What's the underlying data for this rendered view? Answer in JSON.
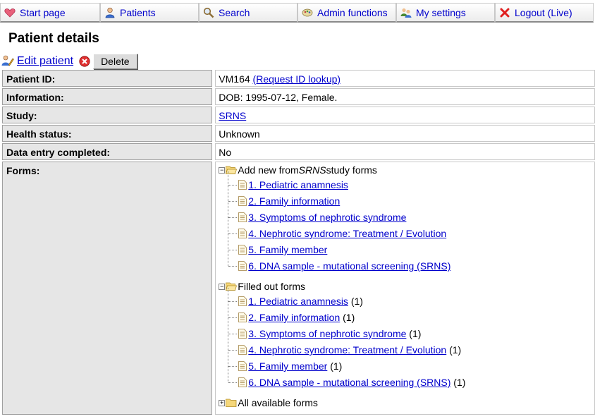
{
  "nav": {
    "items": [
      {
        "label": "Start page",
        "icon": "heart-icon"
      },
      {
        "label": "Patients",
        "icon": "person-icon"
      },
      {
        "label": "Search",
        "icon": "magnifier-icon"
      },
      {
        "label": "Admin functions",
        "icon": "admin-icon"
      },
      {
        "label": "My settings",
        "icon": "users-settings-icon"
      },
      {
        "label": "Logout (Live)",
        "icon": "red-x-icon"
      }
    ]
  },
  "page": {
    "title": "Patient details",
    "edit_label": "Edit patient",
    "delete_label": "Delete"
  },
  "details": {
    "patient_id_label": "Patient ID:",
    "patient_id_value": "VM164",
    "id_lookup_link": "(Request ID lookup)",
    "information_label": "Information:",
    "information_value": "DOB: 1995-07-12, Female.",
    "study_label": "Study:",
    "study_value": "SRNS",
    "health_label": "Health status:",
    "health_value": "Unknown",
    "completed_label": "Data entry completed:",
    "completed_value": "No",
    "forms_label": "Forms:"
  },
  "forms": {
    "add_new": {
      "prefix": "Add new from ",
      "study": "SRNS",
      "suffix": " study forms",
      "items": [
        "1. Pediatric anamnesis",
        "2. Family information",
        "3. Symptoms of nephrotic syndrome",
        "4. Nephrotic syndrome: Treatment / Evolution",
        "5. Family member",
        "6. DNA sample - mutational screening (SRNS)"
      ]
    },
    "filled_out": {
      "label": "Filled out forms",
      "items": [
        {
          "name": "1. Pediatric anamnesis",
          "count": "(1)"
        },
        {
          "name": "2. Family information",
          "count": "(1)"
        },
        {
          "name": "3. Symptoms of nephrotic syndrome",
          "count": "(1)"
        },
        {
          "name": "4. Nephrotic syndrome: Treatment / Evolution",
          "count": "(1)"
        },
        {
          "name": "5. Family member",
          "count": "(1)"
        },
        {
          "name": "6. DNA sample - mutational screening (SRNS)",
          "count": "(1)"
        }
      ]
    },
    "all_available": {
      "label": "All available forms"
    }
  }
}
